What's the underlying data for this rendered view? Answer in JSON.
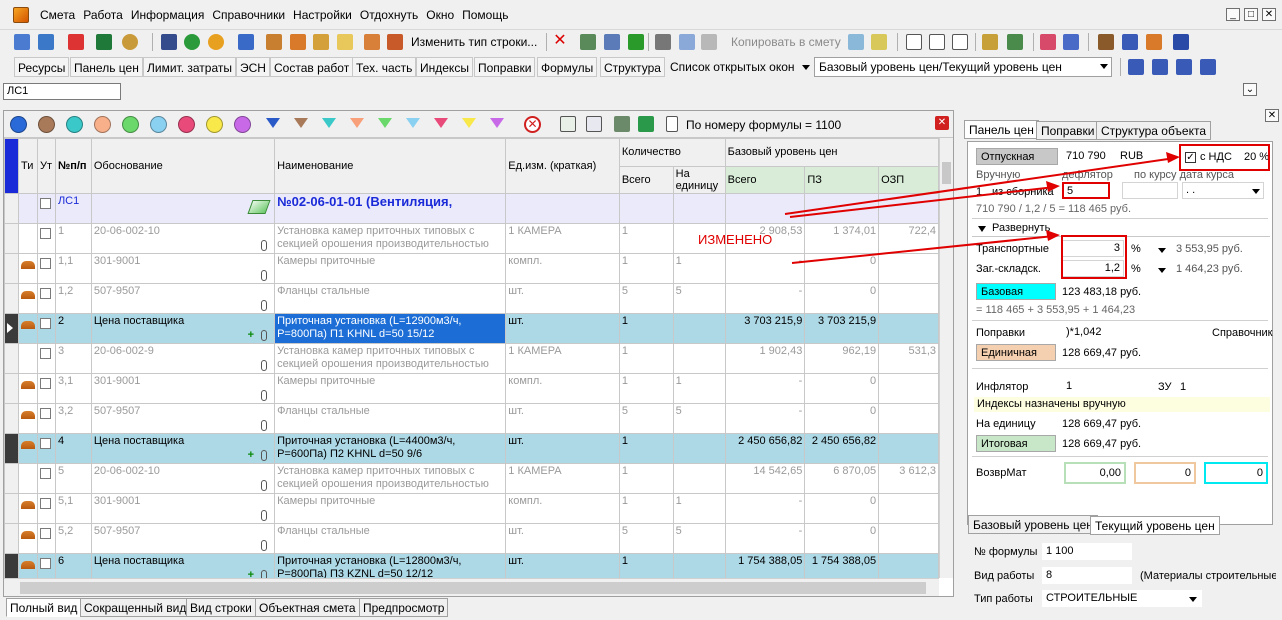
{
  "menu": [
    "Смета",
    "Работа",
    "Информация",
    "Справочники",
    "Настройки",
    "Отдохнуть",
    "Окно",
    "Помощь"
  ],
  "toolbar1": {
    "change_row_type": "Изменить тип строки...",
    "copy_to_estimate": "Копировать в смету"
  },
  "toolbar2": {
    "tabs": [
      "Ресурсы",
      "Панель цен",
      "Лимит. затраты",
      "ЭСН",
      "Состав работ",
      "Тех. часть",
      "Индексы",
      "Поправки",
      "Формулы",
      "Структура"
    ],
    "open_windows": "Список открытых окон",
    "price_level": "Базовый уровень цен/Текущий уровень цен"
  },
  "path": "ЛС1",
  "formula_filter": "По номеру формулы = 1100",
  "grid": {
    "headers": {
      "ti": "Ти",
      "ut": "Ут",
      "num": "№п/п",
      "basis": "Обоснование",
      "name": "Наименование",
      "unit": "Ед.изм. (краткая)",
      "qty": "Количество",
      "qty_total": "Всего",
      "qty_unit": "На единицу",
      "base_price": "Базовый уровень цен",
      "total": "Всего",
      "pz": "ПЗ",
      "ozp": "ОЗП"
    },
    "section": {
      "num": "ЛС1",
      "title": "№02-06-01-01 (Вентиляция,"
    },
    "rows": [
      {
        "num": "1",
        "basis": "20-06-002-10",
        "name": "Установка камер приточных типовых с секцией орошения производительностью",
        "unit": "1 КАМЕРА",
        "qty": "1",
        "qty_unit": "",
        "total": "2 908,53",
        "pz": "1 374,01",
        "ozp": "722,4",
        "style": "grey"
      },
      {
        "num": "1,1",
        "basis": "301-9001",
        "name": "Камеры приточные",
        "unit": "компл.",
        "qty": "1",
        "qty_unit": "1",
        "total": "-",
        "pz": "0",
        "ozp": "",
        "style": "grey"
      },
      {
        "num": "1,2",
        "basis": "507-9507",
        "name": "Фланцы стальные",
        "unit": "шт.",
        "qty": "5",
        "qty_unit": "5",
        "total": "-",
        "pz": "0",
        "ozp": "",
        "style": "grey"
      },
      {
        "num": "2",
        "basis": "Цена поставщика",
        "name": "Приточная установка (L=12900м3/ч, P=800Па) П1 KHNL d=50 15/12",
        "unit": "шт.",
        "qty": "1",
        "qty_unit": "",
        "total": "3 703 215,9",
        "pz": "3 703 215,9",
        "ozp": "",
        "style": "sel"
      },
      {
        "num": "3",
        "basis": "20-06-002-9",
        "name": "Установка камер приточных типовых с секцией орошения производительностью",
        "unit": "1 КАМЕРА",
        "qty": "1",
        "qty_unit": "",
        "total": "1 902,43",
        "pz": "962,19",
        "ozp": "531,3",
        "style": "grey"
      },
      {
        "num": "3,1",
        "basis": "301-9001",
        "name": "Камеры приточные",
        "unit": "компл.",
        "qty": "1",
        "qty_unit": "1",
        "total": "-",
        "pz": "0",
        "ozp": "",
        "style": "grey"
      },
      {
        "num": "3,2",
        "basis": "507-9507",
        "name": "Фланцы стальные",
        "unit": "шт.",
        "qty": "5",
        "qty_unit": "5",
        "total": "-",
        "pz": "0",
        "ozp": "",
        "style": "grey"
      },
      {
        "num": "4",
        "basis": "Цена поставщика",
        "name": "Приточная установка (L=4400м3/ч, P=600Па) П2 KHNL d=50 9/6",
        "unit": "шт.",
        "qty": "1",
        "qty_unit": "",
        "total": "2 450 656,82",
        "pz": "2 450 656,82",
        "ozp": "",
        "style": "sel2"
      },
      {
        "num": "5",
        "basis": "20-06-002-10",
        "name": "Установка камер приточных типовых с секцией орошения производительностью",
        "unit": "1 КАМЕРА",
        "qty": "1",
        "qty_unit": "",
        "total": "14 542,65",
        "pz": "6 870,05",
        "ozp": "3 612,3",
        "style": "grey"
      },
      {
        "num": "5,1",
        "basis": "301-9001",
        "name": "Камеры приточные",
        "unit": "компл.",
        "qty": "1",
        "qty_unit": "1",
        "total": "-",
        "pz": "0",
        "ozp": "",
        "style": "grey"
      },
      {
        "num": "5,2",
        "basis": "507-9507",
        "name": "Фланцы стальные",
        "unit": "шт.",
        "qty": "5",
        "qty_unit": "5",
        "total": "-",
        "pz": "0",
        "ozp": "",
        "style": "grey"
      },
      {
        "num": "6",
        "basis": "Цена поставщика",
        "name": "Приточная установка (L=12800м3/ч, P=800Па) П3 KZNL d=50 12/12",
        "unit": "шт.",
        "qty": "1",
        "qty_unit": "",
        "total": "1 754 388,05",
        "pz": "1 754 388,05",
        "ozp": "",
        "style": "sel2"
      }
    ]
  },
  "bottom_tabs": [
    "Полный вид",
    "Сокращенный вид",
    "Вид строки",
    "Объектная смета",
    "Предпросмотр"
  ],
  "right": {
    "tabs": [
      "Панель цен",
      "Поправки",
      "Структура объекта"
    ],
    "otpusknaya_label": "Отпускная",
    "otpusknaya_value": "710 790",
    "currency": "RUB",
    "nds_label": "с НДС",
    "nds_value": "20 %",
    "manual_label": "Вручную",
    "deflator_label": "дефлятор",
    "by_rate_label": "по курсу дата курса",
    "from_collections_prefix": "1",
    "from_collections_label": "из сборника",
    "from_collections_value": "5",
    "rate_dots": ". .",
    "calc_formula": "710 790 / 1,2 / 5 = 118 465 руб.",
    "changed_label": "ИЗМЕНЕНО",
    "expand_label": "Развернуть",
    "transport_label": "Транспортные",
    "transport_value": "3",
    "transport_pct": "%",
    "transport_sum": "3 553,95 руб.",
    "storage_label": "Заг.-складск.",
    "storage_value": "1,2",
    "storage_pct": "%",
    "storage_sum": "1 464,23 руб.",
    "base_label": "Базовая",
    "base_value": "123 483,18 руб.",
    "base_formula": "= 118 465 + 3 553,95 + 1 464,23",
    "corrections_label": "Поправки",
    "corrections_value": ")*1,042",
    "reference_label": "Справочник",
    "unit_label": "Единичная",
    "unit_value": "128 669,47 руб.",
    "inflator_label": "Инфлятор",
    "inflator_value": "1",
    "zu_label": "ЗУ",
    "zu_value": "1",
    "indices_note": "Индексы назначены вручную",
    "per_unit_label": "На единицу",
    "per_unit_value": "128 669,47 руб.",
    "final_label": "Итоговая",
    "final_value": "128 669,47 руб.",
    "vozvrmat_label": "ВозврМат",
    "vozvr_1": "0,00",
    "vozvr_2": "0",
    "vozvr_3": "0",
    "level_tabs": [
      "Базовый уровень цен",
      "Текущий уровень цен"
    ],
    "formula_num_label": "№ формулы",
    "formula_num_value": "1 100",
    "work_type_label": "Вид работы",
    "work_type_value": "8",
    "work_type_desc": "(Материалы строительные",
    "work_kind_label": "Тип работы",
    "work_kind_value": "СТРОИТЕЛЬНЫЕ"
  },
  "colors": {
    "selected_row": "#add8e6",
    "current_cell": "#1c6ed6",
    "annotation_red": "#e00000",
    "base_cyan": "#00ffff",
    "unit_peach": "#f5d0b0",
    "final_green": "#c8e6c8"
  }
}
